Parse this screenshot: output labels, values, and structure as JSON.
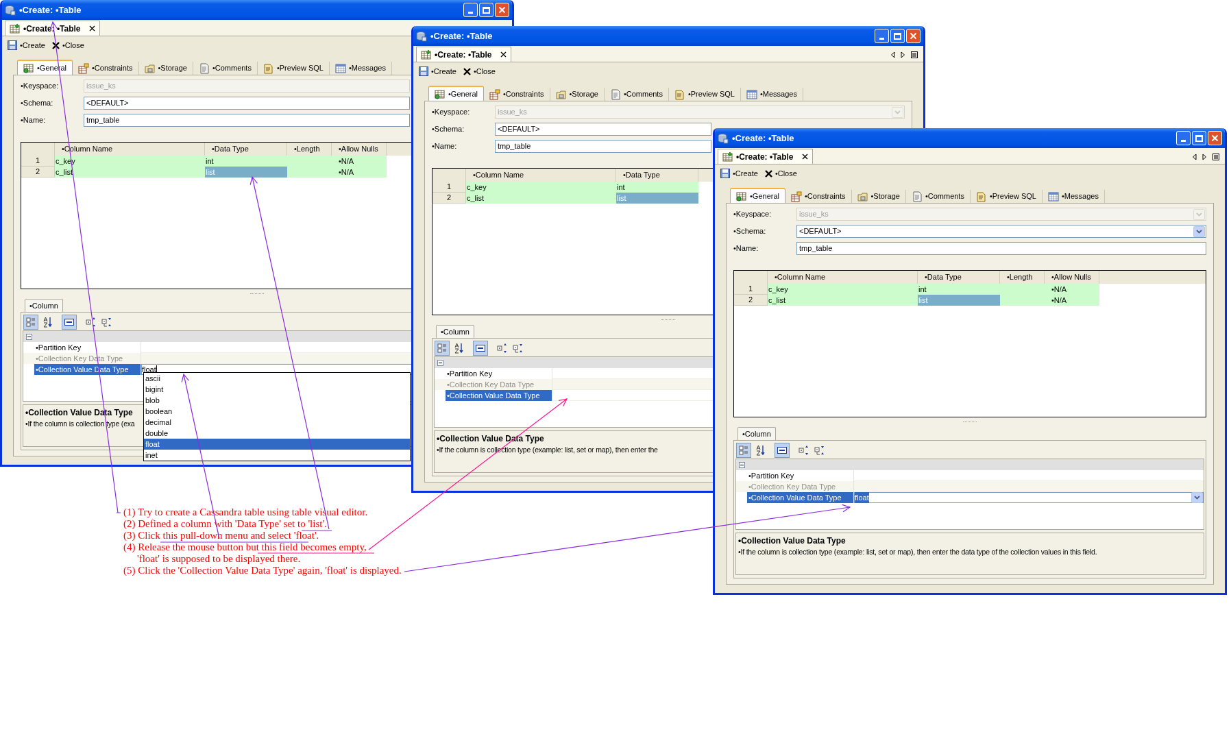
{
  "windows": [
    {
      "title": "•Create: •Table",
      "editor_tab": {
        "label": "•Create: •Table",
        "selected": true
      },
      "toolbar": [
        "•Create",
        "•Close"
      ],
      "tabs": [
        {
          "label": "•General",
          "selected": true
        },
        {
          "label": "•Constraints",
          "selected": false
        },
        {
          "label": "•Storage",
          "selected": false
        },
        {
          "label": "•Comments",
          "selected": false
        },
        {
          "label": "•Preview SQL",
          "selected": false
        },
        {
          "label": "•Messages",
          "selected": false
        }
      ],
      "form": [
        {
          "label": "•Keyspace:",
          "value": "issue_ks",
          "disabled": true
        },
        {
          "label": "•Schema:",
          "value": "<DEFAULT>",
          "disabled": false
        },
        {
          "label": "•Name:",
          "value": "tmp_table",
          "disabled": false
        }
      ],
      "table": {
        "columns": [
          "•Column Name",
          "•Data Type",
          "•Length",
          "•Allow Nulls"
        ],
        "rows": [
          {
            "number": "1",
            "name": "c_key",
            "data_type": "int",
            "data_type_selected": false,
            "allow_nulls": "•N/A"
          },
          {
            "number": "2",
            "name": "c_list",
            "data_type": "list",
            "data_type_selected": true,
            "allow_nulls": "•N/A"
          }
        ]
      },
      "column_tab": "•Column",
      "properties": [
        {
          "label": "•Partition Key",
          "disabled": false,
          "selected": false
        },
        {
          "label": "•Collection Key Data Type",
          "disabled": true,
          "selected": false
        },
        {
          "label": "•Collection Value Data Type",
          "disabled": false,
          "selected": true,
          "value": "float",
          "value_selected": false
        }
      ],
      "dropdown": [
        {
          "label": "ascii",
          "selected": false
        },
        {
          "label": "bigint",
          "selected": false
        },
        {
          "label": "blob",
          "selected": false
        },
        {
          "label": "boolean",
          "selected": false
        },
        {
          "label": "decimal",
          "selected": false
        },
        {
          "label": "double",
          "selected": false
        },
        {
          "label": "float",
          "selected": true
        },
        {
          "label": "inet",
          "selected": false
        }
      ],
      "description": {
        "title": "•Collection Value Data Type",
        "text": "•If the column is collection type (exa"
      }
    },
    {
      "title": "•Create: •Table",
      "editor_tab": {
        "label": "•Create: •Table",
        "selected": true
      },
      "toolbar": [
        "•Create",
        "•Close"
      ],
      "tabs": [
        {
          "label": "•General",
          "selected": true
        },
        {
          "label": "•Constraints",
          "selected": false
        },
        {
          "label": "•Storage",
          "selected": false
        },
        {
          "label": "•Comments",
          "selected": false
        },
        {
          "label": "•Preview SQL",
          "selected": false
        },
        {
          "label": "•Messages",
          "selected": false
        }
      ],
      "form": [
        {
          "label": "•Keyspace:",
          "value": "issue_ks",
          "disabled": true
        },
        {
          "label": "•Schema:",
          "value": "<DEFAULT>",
          "disabled": false
        },
        {
          "label": "•Name:",
          "value": "tmp_table",
          "disabled": false
        }
      ],
      "table": {
        "columns": [
          "•Column Name",
          "•Data Type"
        ],
        "rows": [
          {
            "number": "1",
            "name": "c_key",
            "data_type": "int",
            "data_type_selected": false
          },
          {
            "number": "2",
            "name": "c_list",
            "data_type": "list",
            "data_type_selected": true
          }
        ]
      },
      "column_tab": "•Column",
      "properties": [
        {
          "label": "•Partition Key",
          "disabled": false,
          "selected": false
        },
        {
          "label": "•Collection Key Data Type",
          "disabled": true,
          "selected": false
        },
        {
          "label": "•Collection Value Data Type",
          "disabled": false,
          "selected": true
        }
      ],
      "description": {
        "title": "•Collection Value Data Type",
        "text": "•If the column is collection type (example: list, set or map), then enter the"
      }
    },
    {
      "title": "•Create: •Table",
      "editor_tab": {
        "label": "•Create: •Table",
        "selected": true
      },
      "toolbar": [
        "•Create",
        "•Close"
      ],
      "tabs": [
        {
          "label": "•General",
          "selected": true
        },
        {
          "label": "•Constraints",
          "selected": false
        },
        {
          "label": "•Storage",
          "selected": false
        },
        {
          "label": "•Comments",
          "selected": false
        },
        {
          "label": "•Preview SQL",
          "selected": false
        },
        {
          "label": "•Messages",
          "selected": false
        }
      ],
      "form": [
        {
          "label": "•Keyspace:",
          "value": "issue_ks",
          "disabled": true
        },
        {
          "label": "•Schema:",
          "value": "<DEFAULT>",
          "disabled": false
        },
        {
          "label": "•Name:",
          "value": "tmp_table",
          "disabled": false
        }
      ],
      "table": {
        "columns": [
          "•Column Name",
          "•Data Type",
          "•Length",
          "•Allow Nulls"
        ],
        "rows": [
          {
            "number": "1",
            "name": "c_key",
            "data_type": "int",
            "data_type_selected": false,
            "allow_nulls": "•N/A"
          },
          {
            "number": "2",
            "name": "c_list",
            "data_type": "list",
            "data_type_selected": true,
            "allow_nulls": "•N/A"
          }
        ]
      },
      "column_tab": "•Column",
      "properties": [
        {
          "label": "•Partition Key",
          "disabled": false,
          "selected": false
        },
        {
          "label": "•Collection Key Data Type",
          "disabled": true,
          "selected": false
        },
        {
          "label": "•Collection Value Data Type",
          "disabled": false,
          "selected": true,
          "value": "float",
          "value_selected": true
        }
      ],
      "description": {
        "title": "•Collection Value Data Type",
        "text": "•If the column is collection type (example: list, set or map), then enter the data type of the collection values in this field."
      }
    }
  ],
  "annotations": [
    {
      "text": "(1) Try to create a Cassandra table using table visual editor.",
      "kind": "step"
    },
    {
      "text": "(2) Defined a column with 'Data Type' set to 'list'.",
      "kind": "step"
    },
    {
      "text": "(3) Click this pull-down menu and select 'float'.",
      "kind": "step"
    },
    {
      "text": "(4) Release the mouse button but this field becomes empty,",
      "kind": "step"
    },
    {
      "text": "'float' is supposed to be displayed there.",
      "kind": "continuation"
    },
    {
      "text": "(5) Click the 'Collection Value Data Type' again, 'float' is displayed.",
      "kind": "step"
    }
  ]
}
